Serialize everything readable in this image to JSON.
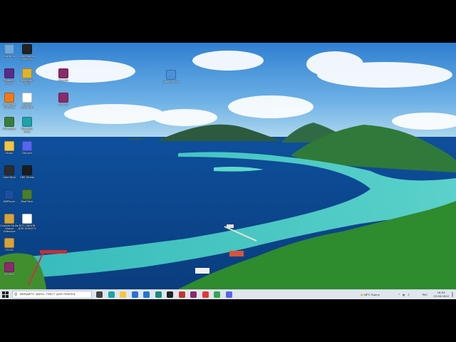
{
  "desktop": {
    "icons": [
      {
        "label": "Корзина",
        "icon": "recycle-bin-icon",
        "color": "#6fa8dc"
      },
      {
        "label": "Epic Games Launcher",
        "icon": "epic-games-icon",
        "color": "#222222"
      },
      {
        "label": "Pinnacle Studio",
        "icon": "pinnacle-icon",
        "color": "#5b2a86"
      },
      {
        "label": "Revolution Build",
        "icon": "app-icon",
        "color": "#e0b32c"
      },
      {
        "label": "WinRAR",
        "icon": "winrar-icon",
        "color": "#8b2a6b"
      },
      {
        "label": "Avast Free Antivirus",
        "icon": "avast-icon",
        "color": "#f07a1a"
      },
      {
        "label": "Новый документ",
        "icon": "document-icon",
        "color": "#ffffff"
      },
      {
        "label": "Archive",
        "icon": "winrar-icon",
        "color": "#8b2a6b"
      },
      {
        "label": "VirtualBox",
        "icon": "box-icon",
        "color": "#3a7d3a"
      },
      {
        "label": "Microsoft Edge",
        "icon": "edge-icon",
        "color": "#1ea2a8"
      },
      {
        "label": "Игры",
        "icon": "folder-icon",
        "color": "#f4c542"
      },
      {
        "label": "Discord",
        "icon": "discord-icon",
        "color": "#5865f2"
      },
      {
        "label": "OpenShot",
        "icon": "video-editor-icon",
        "color": "#2b2b2b"
      },
      {
        "label": "OBS Studio",
        "icon": "obs-icon",
        "color": "#1c1c1c"
      },
      {
        "label": "KMPlayer",
        "icon": "media-player-icon",
        "color": "#1a4fa0"
      },
      {
        "label": "Mod Pack",
        "icon": "game-icon",
        "color": "#4a7d2a"
      },
      {
        "label": "Counter-Strike Global Offensive",
        "icon": "csgo-icon",
        "color": "#d8a23a"
      },
      {
        "label": "БОТ_ОБНОВ ДЛЯ НОВОГО",
        "icon": "document-icon",
        "color": "#ffffff"
      },
      {
        "label": "CS:GO",
        "icon": "csgo-icon",
        "color": "#d8a23a"
      },
      {
        "label": "WinRAR",
        "icon": "winrar-icon",
        "color": "#8b2a6b"
      },
      {
        "label": "Новая папка",
        "icon": "folder-shortcut-icon",
        "color": "#4a90d9"
      }
    ]
  },
  "taskbar": {
    "search_placeholder": "Введите здесь текст для поиска",
    "pinned": [
      {
        "name": "task-view-icon",
        "color": "#444444"
      },
      {
        "name": "edge-icon",
        "color": "#1ea2a8"
      },
      {
        "name": "file-explorer-icon",
        "color": "#f4c542"
      },
      {
        "name": "store-icon",
        "color": "#2a6fd6"
      },
      {
        "name": "mail-icon",
        "color": "#1f78d1"
      },
      {
        "name": "app-icon",
        "color": "#1a8a7a"
      },
      {
        "name": "obs-icon",
        "color": "#222222"
      },
      {
        "name": "pdf-icon",
        "color": "#c0392b"
      },
      {
        "name": "winrar-icon",
        "color": "#8b2a6b"
      },
      {
        "name": "yandex-icon",
        "color": "#e53935"
      },
      {
        "name": "chrome-icon",
        "color": "#34a853"
      },
      {
        "name": "discord-icon",
        "color": "#5865f2"
      }
    ],
    "weather": "28°C  Sunny",
    "language": "РУС",
    "time": "16:53",
    "date": "23.06.2022"
  }
}
